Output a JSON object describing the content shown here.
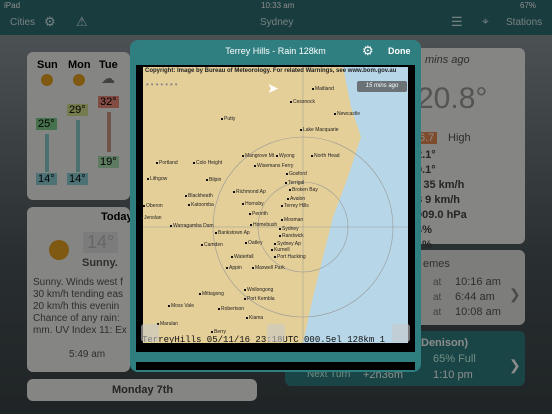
{
  "status": {
    "device": "iPad",
    "time": "10:33 am",
    "battery": "67%"
  },
  "nav": {
    "cities": "Cities",
    "title": "Sydney",
    "stations": "Stations"
  },
  "forecast": {
    "days": [
      "Sun",
      "Mon",
      "Tue"
    ],
    "highs": [
      "25°",
      "29°",
      "32°"
    ],
    "lows": [
      "14°",
      "14°",
      "19°"
    ],
    "today_label": "Today",
    "today_temp": "14°",
    "today_summary": "Sunny.",
    "today_text": [
      "Sunny. Winds west f",
      "30 km/h tending eas",
      "20 km/h this evenin",
      "Chance of any rain:",
      "mm. UV Index 11: Ex"
    ],
    "sunrise": "5:49 am",
    "next_day": "Monday 7th"
  },
  "current": {
    "updated": "mins ago",
    "temp": "20.8°",
    "high_val": "6.7",
    "high_label": "High",
    "rows": [
      "2.1°",
      "0.1°",
      "r 35 km/h",
      "3 9 km/h",
      "009.0 hPa",
      "4%",
      "1%"
    ],
    "tides_label": "emes",
    "tides": [
      {
        "at": "at",
        "time": "10:16 am"
      },
      {
        "at": "at",
        "time": "6:44 am"
      },
      {
        "at": "at",
        "time": "10:08 am"
      }
    ],
    "moon_title": "Denison)",
    "moon_full": "65% Full",
    "next_turn_label": "Next Turn",
    "next_turn": "+2h36m",
    "next_turn_time": "1:10 pm"
  },
  "modal": {
    "title": "Terrey Hills - Rain 128km",
    "done": "Done",
    "copyright": "Copyright: Image by Bureau of Meteorology. For related Warnings, see www.bom.gov.au",
    "timestamp": "15 mins ago",
    "caption": "TerreyHills 05/11/16 23:18UTC 000.5el 128km 1",
    "places": [
      "Maitland",
      "Cessnock",
      "Newcastle",
      "Lake Macquarie",
      "Putty",
      "Mangrove Mt",
      "Wyong",
      "North Head",
      "Gosford",
      "Terrigal",
      "Wisemans Ferry",
      "Portland",
      "Colo Height",
      "Lithgow",
      "Bilpin",
      "Broken Bay",
      "Richmond Ap",
      "Avalon",
      "Blackheath",
      "Katoomba",
      "Hornsby",
      "Terrey Hills",
      "Oberon",
      "Jenolan",
      "Penrith",
      "Mosman",
      "Warragamba Dam",
      "Homebush",
      "Sydney",
      "Bankstown Ap",
      "Randwick",
      "Sydney Ap",
      "Camden",
      "Oatley",
      "Kurnell",
      "Waterfall",
      "Port Hacking",
      "Appin",
      "Maxwell Park",
      "Wollongong",
      "Mittagong",
      "Port Kembla",
      "Moss Vale",
      "Robertson",
      "Kiama",
      "Marulan",
      "Berry"
    ],
    "colors": {
      "map": "#e5cf98",
      "modal": "#2f7e80",
      "text": "#222222"
    }
  }
}
